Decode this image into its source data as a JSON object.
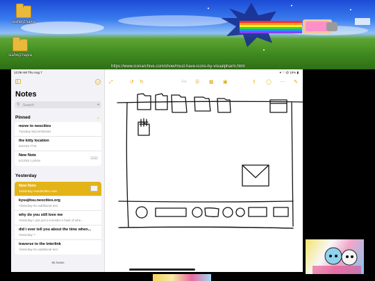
{
  "desktop": {
    "icons": [
      {
        "label": "siahwjznajva"
      },
      {
        "label": "siahwjznajva"
      }
    ],
    "overlay_url": "https://www.iconarchive.com/show/must-have-icons-by-visualpharm.html"
  },
  "ipad": {
    "status": {
      "time": "12:09 AM  Thu Aug 7",
      "right": "▾ ♡ @ 15% ▮"
    },
    "sidebar": {
      "title": "Notes",
      "search_placeholder": "Search",
      "pinned_label": "Pinned",
      "pinned": [
        {
          "title": "move to neocities",
          "subtitle": "Tuesday  MyCertsDead"
        },
        {
          "title": "the kitty location",
          "subtitle": "8/22/25  7/7E"
        },
        {
          "title": "New Note",
          "subtitle": "6/13/25  1 photo"
        }
      ],
      "yesterday_label": "Yesterday",
      "yesterday": [
        {
          "title": "New Note",
          "subtitle": "Yesterday  Handwritten note",
          "selected": true
        },
        {
          "title": "kyuujitsu.neocities.org",
          "subtitle": "Yesterday  No additional text"
        },
        {
          "title": "why do you still love me",
          "subtitle": "Yesterday  I just just a monster a husk of whe..."
        },
        {
          "title": "did i ever tell you about the time when...",
          "subtitle": "Yesterday  ?"
        },
        {
          "title": "traverse to the interlink",
          "subtitle": "Yesterday  No additional text"
        }
      ],
      "notes_count": "95 Notes"
    },
    "toolbar": {
      "left_icons": [
        "expand-icon",
        "undo-icon",
        "redo-icon"
      ],
      "center_icons": [
        "text-format-icon",
        "checklist-icon",
        "table-icon",
        "camera-icon"
      ],
      "right_icons": [
        "share-icon",
        "markup-icon",
        "more-icon",
        "compose-icon"
      ],
      "accent": "#e0a800"
    }
  },
  "colors": {
    "selected_note": "#e3b318",
    "sidebar_bg": "#f2f2f7"
  }
}
